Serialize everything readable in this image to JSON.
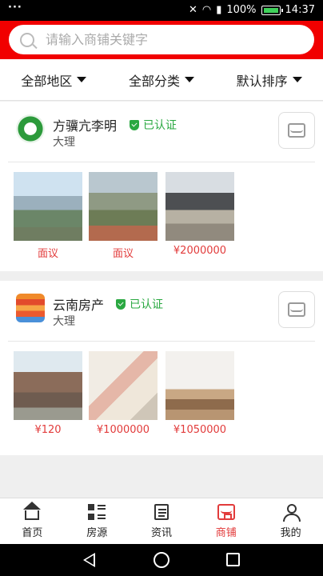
{
  "status_bar": {
    "menu": "···",
    "battery": "100%",
    "time": "14:37"
  },
  "search": {
    "placeholder": "请输入商铺关键字"
  },
  "filters": [
    {
      "label": "全部地区"
    },
    {
      "label": "全部分类"
    },
    {
      "label": "默认排序"
    }
  ],
  "stores": [
    {
      "name": "方骥亢李明",
      "verified": "已认证",
      "city": "大理",
      "listings": [
        {
          "price": "面议"
        },
        {
          "price": "面议"
        },
        {
          "price": "¥2000000"
        }
      ]
    },
    {
      "name": "云南房产",
      "verified": "已认证",
      "city": "大理",
      "listings": [
        {
          "price": "¥120"
        },
        {
          "price": "¥1000000"
        },
        {
          "price": "¥1050000"
        }
      ]
    }
  ],
  "bottom_nav": [
    {
      "label": "首页",
      "icon": "home-icon"
    },
    {
      "label": "房源",
      "icon": "listings-icon"
    },
    {
      "label": "资讯",
      "icon": "news-icon"
    },
    {
      "label": "商铺",
      "icon": "shop-icon",
      "active": true
    },
    {
      "label": "我的",
      "icon": "user-icon"
    }
  ],
  "colors": {
    "header": "#f10000",
    "accent": "#e23b3b",
    "verified": "#2aa841"
  }
}
